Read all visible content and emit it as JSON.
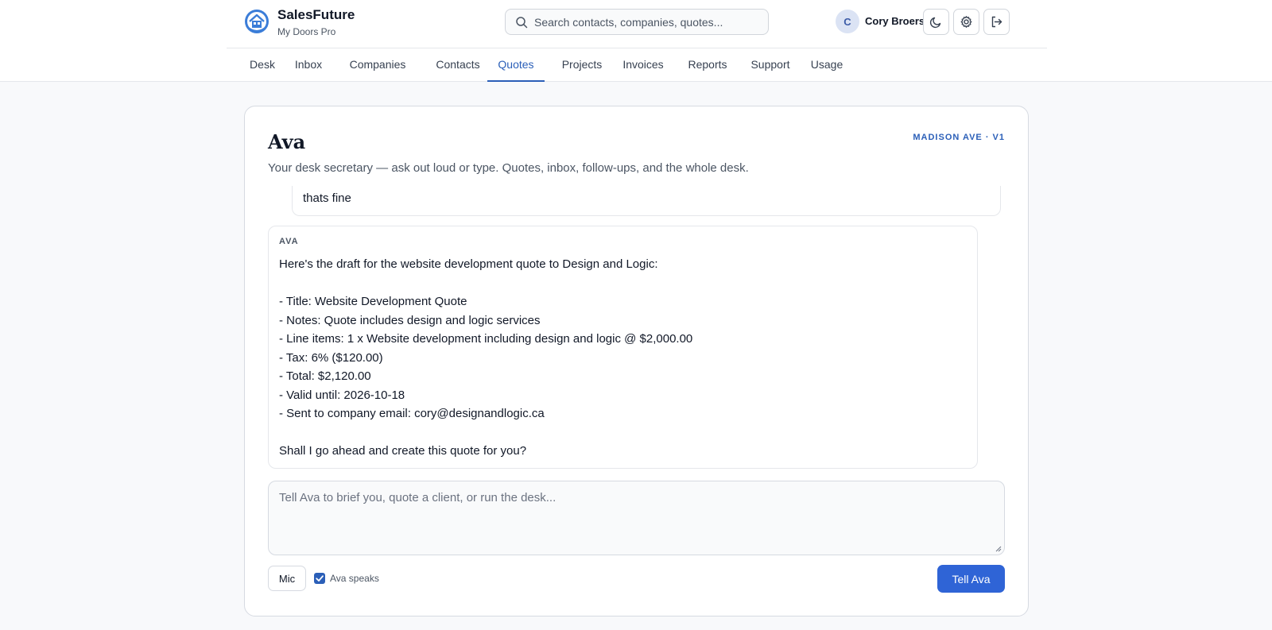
{
  "brand": {
    "name": "SalesFuture",
    "subtitle": "My Doors Pro"
  },
  "search": {
    "placeholder": "Search contacts, companies, quotes..."
  },
  "user": {
    "initial": "C",
    "name": "Cory Broersma"
  },
  "header_icons": [
    "moon-icon",
    "gear-icon",
    "logout-icon"
  ],
  "nav": {
    "items": [
      {
        "label": "Desk"
      },
      {
        "label": "Inbox"
      },
      {
        "label": "Companies"
      },
      {
        "label": "Contacts"
      },
      {
        "label": "Quotes",
        "active": true
      },
      {
        "label": "Projects"
      },
      {
        "label": "Invoices"
      },
      {
        "label": "Reports"
      },
      {
        "label": "Support"
      },
      {
        "label": "Usage"
      }
    ]
  },
  "assistant": {
    "title": "Ava",
    "tag": "MADISON AVE · V1",
    "subtitle": "Your desk secretary — ask out loud or type. Quotes, inbox, follow-ups, and the whole desk."
  },
  "conversation": {
    "user_message": "thats fine",
    "ava_label": "AVA",
    "ava_message": "Here's the draft for the website development quote to Design and Logic:\n\n- Title: Website Development Quote\n- Notes: Quote includes design and logic services\n- Line items: 1 x Website development including design and logic @ $2,000.00\n- Tax: 6% ($120.00)\n- Total: $2,120.00\n- Valid until: 2026-10-18\n- Sent to company email: cory@designandlogic.ca\n\nShall I go ahead and create this quote for you?"
  },
  "composer": {
    "placeholder": "Tell Ava to brief you, quote a client, or run the desk...",
    "mic_label": "Mic",
    "speaks_label": "Ava speaks",
    "speaks_checked": true,
    "send_label": "Tell Ava"
  },
  "colors": {
    "accent": "#2b5fb8",
    "primary_button": "#2f64d6",
    "avatar_bg": "#dbe3f4"
  }
}
